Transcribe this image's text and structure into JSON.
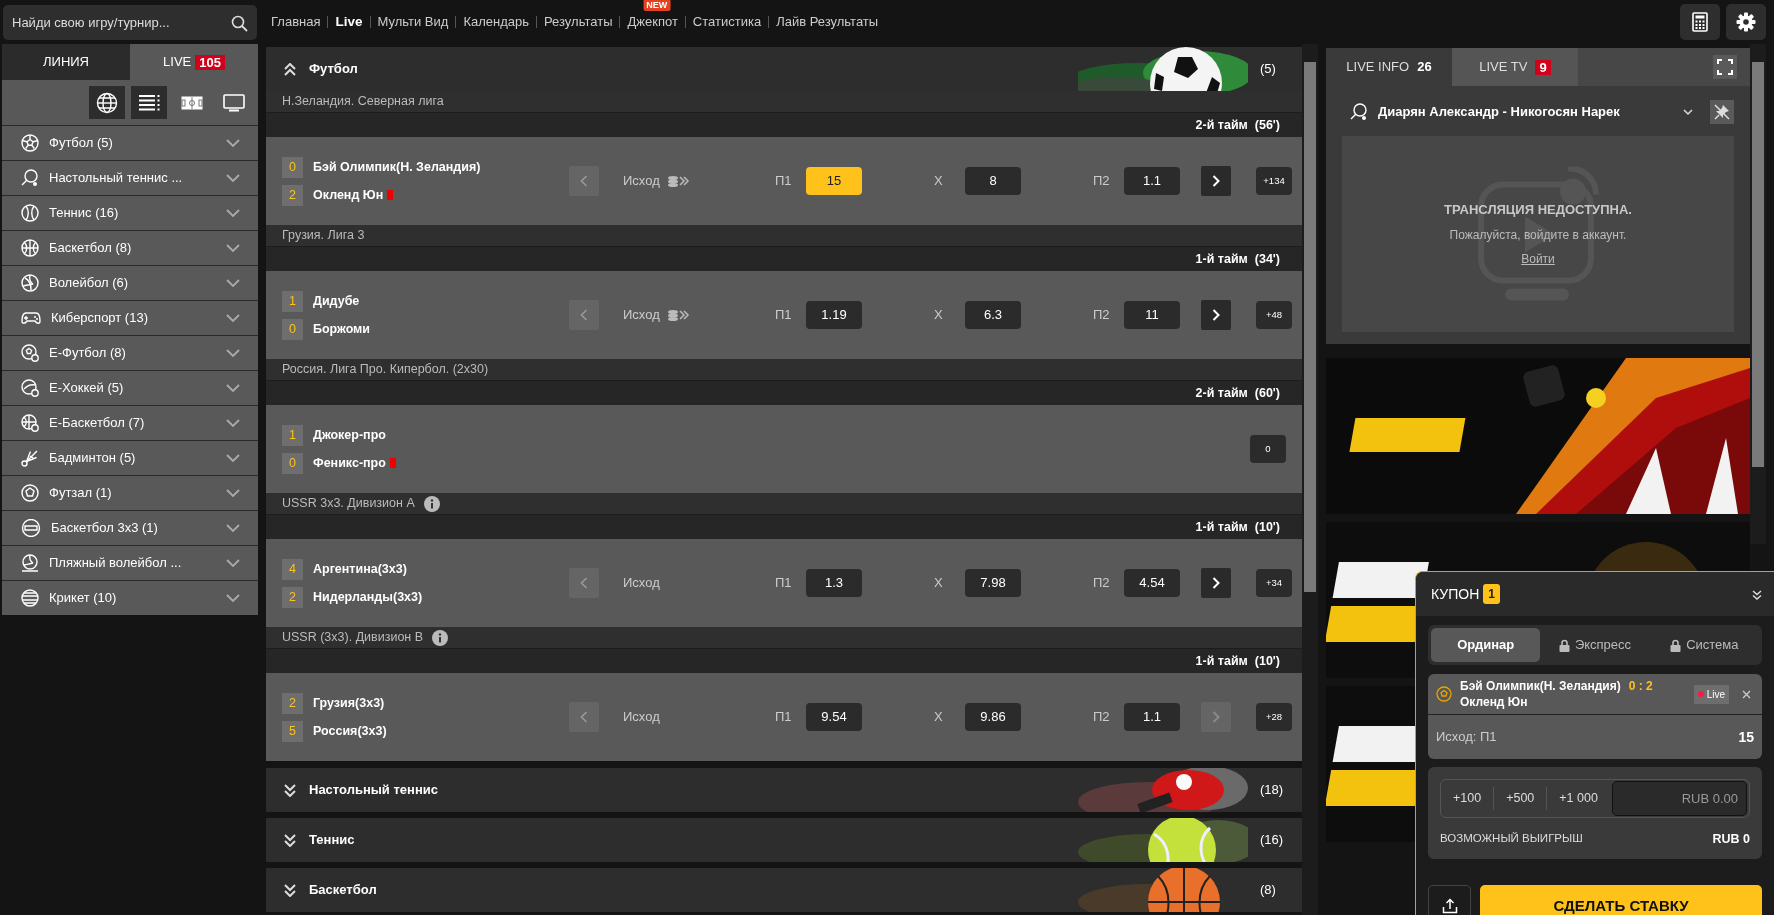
{
  "search": {
    "placeholder": "Найди свою игру/турнир..."
  },
  "nav": [
    {
      "label": "Главная",
      "selected": false
    },
    {
      "label": "Live",
      "selected": true
    },
    {
      "label": "Мульти Вид",
      "selected": false
    },
    {
      "label": "Календарь",
      "selected": false
    },
    {
      "label": "Результаты",
      "selected": false
    },
    {
      "label": "Джекпот",
      "selected": false,
      "badge": "NEW"
    },
    {
      "label": "Статистика",
      "selected": false
    },
    {
      "label": "Лайв Результаты",
      "selected": false
    }
  ],
  "sidebar": {
    "tabs": [
      {
        "label": "ЛИНИЯ",
        "selected": false
      },
      {
        "label": "LIVE",
        "selected": true,
        "badge": "105"
      }
    ],
    "view_modes": [
      {
        "selected": true
      },
      {
        "selected": true
      },
      {
        "selected": false
      },
      {
        "selected": false
      }
    ],
    "sports": [
      {
        "label": "Футбол (5)"
      },
      {
        "label": "Настольный теннис ..."
      },
      {
        "label": "Теннис (16)"
      },
      {
        "label": "Баскетбол (8)"
      },
      {
        "label": "Волейбол (6)"
      },
      {
        "label": "Киберспорт (13)"
      },
      {
        "label": "Е-Футбол (8)"
      },
      {
        "label": "Е-Хоккей (5)"
      },
      {
        "label": "Е-Баскетбол (7)"
      },
      {
        "label": "Бадминтон (5)"
      },
      {
        "label": "Футзал (1)"
      },
      {
        "label": "Баскетбол 3х3 (1)"
      },
      {
        "label": "Пляжный волейбол ..."
      },
      {
        "label": "Крикет (10)"
      }
    ]
  },
  "sections": [
    {
      "title": "Футбол",
      "count": "(5)",
      "expanded": true,
      "leagues": [
        {
          "name": "Н.Зеландия. Северная лига",
          "info": false,
          "period": "2-й тайм  (56')",
          "teams": [
            {
              "score": "0",
              "name": "Бэй Олимпик(Н. Зеландия)",
              "red_card": false
            },
            {
              "score": "2",
              "name": "Окленд Юн",
              "red_card": true
            }
          ],
          "market": "Исход",
          "market_icon": true,
          "prev_disabled": true,
          "next_disabled": false,
          "odds": [
            {
              "label": "П1",
              "value": "15",
              "selected": true
            },
            {
              "label": "X",
              "value": "8",
              "selected": false
            },
            {
              "label": "П2",
              "value": "1.1",
              "selected": false
            }
          ],
          "more": "+134"
        },
        {
          "name": "Грузия. Лига 3",
          "info": false,
          "period": "1-й тайм  (34')",
          "teams": [
            {
              "score": "1",
              "name": "Дидубе",
              "red_card": false
            },
            {
              "score": "0",
              "name": "Боржоми",
              "red_card": false
            }
          ],
          "market": "Исход",
          "market_icon": true,
          "prev_disabled": true,
          "next_disabled": false,
          "odds": [
            {
              "label": "П1",
              "value": "1.19",
              "selected": false
            },
            {
              "label": "X",
              "value": "6.3",
              "selected": false
            },
            {
              "label": "П2",
              "value": "11",
              "selected": false
            }
          ],
          "more": "+48"
        },
        {
          "name": "Россия. Лига Про. Кипербол. (2x30)",
          "info": false,
          "period": "2-й тайм  (60')",
          "teams": [
            {
              "score": "1",
              "name": "Джокер-про",
              "red_card": false
            },
            {
              "score": "0",
              "name": "Феникс-про",
              "red_card": true
            }
          ],
          "more": "0"
        },
        {
          "name": "USSR 3x3. Дивизион A",
          "info": true,
          "period": "1-й тайм  (10')",
          "teams": [
            {
              "score": "4",
              "name": "Аргентина(3x3)",
              "red_card": false
            },
            {
              "score": "2",
              "name": "Нидерланды(3x3)",
              "red_card": false
            }
          ],
          "market": "Исход",
          "market_icon": false,
          "prev_disabled": true,
          "next_disabled": false,
          "odds": [
            {
              "label": "П1",
              "value": "1.3",
              "selected": false
            },
            {
              "label": "X",
              "value": "7.98",
              "selected": false
            },
            {
              "label": "П2",
              "value": "4.54",
              "selected": false
            }
          ],
          "more": "+34"
        },
        {
          "name": "USSR (3x3). Дивизион B",
          "info": true,
          "period": "1-й тайм  (10')",
          "teams": [
            {
              "score": "2",
              "name": "Грузия(3x3)",
              "red_card": false
            },
            {
              "score": "5",
              "name": "Россия(3x3)",
              "red_card": false
            }
          ],
          "market": "Исход",
          "market_icon": false,
          "prev_disabled": true,
          "next_disabled": true,
          "odds": [
            {
              "label": "П1",
              "value": "9.54",
              "selected": false
            },
            {
              "label": "X",
              "value": "9.86",
              "selected": false
            },
            {
              "label": "П2",
              "value": "1.1",
              "selected": false
            }
          ],
          "more": "+28"
        }
      ]
    },
    {
      "title": "Настольный теннис",
      "count": "(18)",
      "expanded": false
    },
    {
      "title": "Теннис",
      "count": "(16)",
      "expanded": false
    },
    {
      "title": "Баскетбол",
      "count": "(8)",
      "expanded": false
    }
  ],
  "live_panel": {
    "tabs": [
      {
        "label": "LIVE INFO",
        "count": "26",
        "selected": true
      },
      {
        "label": "LIVE TV",
        "badge": "9",
        "selected": false
      }
    ],
    "match": "Диарян Александр - Никогосян Нарек",
    "stream": {
      "title": "ТРАНСЛЯЦИЯ НЕДОСТУПНА.",
      "message": "Пожалуйста, войдите в аккаунт.",
      "link": "Войти"
    }
  },
  "coupon": {
    "title": "КУПОН",
    "count": "1",
    "tabs": [
      {
        "label": "Ординар",
        "selected": true,
        "locked": false
      },
      {
        "label": "Экспресс",
        "selected": false,
        "locked": true
      },
      {
        "label": "Система",
        "selected": false,
        "locked": true
      }
    ],
    "bet": {
      "team1": "Бэй Олимпик(Н. Зеландия)",
      "score": "0 : 2",
      "team2": "Окленд Юн",
      "live": "Live",
      "outcome": "Исход: П1",
      "odds": "15"
    },
    "quick_stakes": [
      "+100",
      "+500",
      "+1 000"
    ],
    "stake": {
      "placeholder": "RUB 0.00"
    },
    "win_label": "ВОЗМОЖНЫЙ ВЫИГРЫШ",
    "win_value": "RUB 0",
    "submit": "СДЕЛАТЬ СТАВКУ"
  }
}
